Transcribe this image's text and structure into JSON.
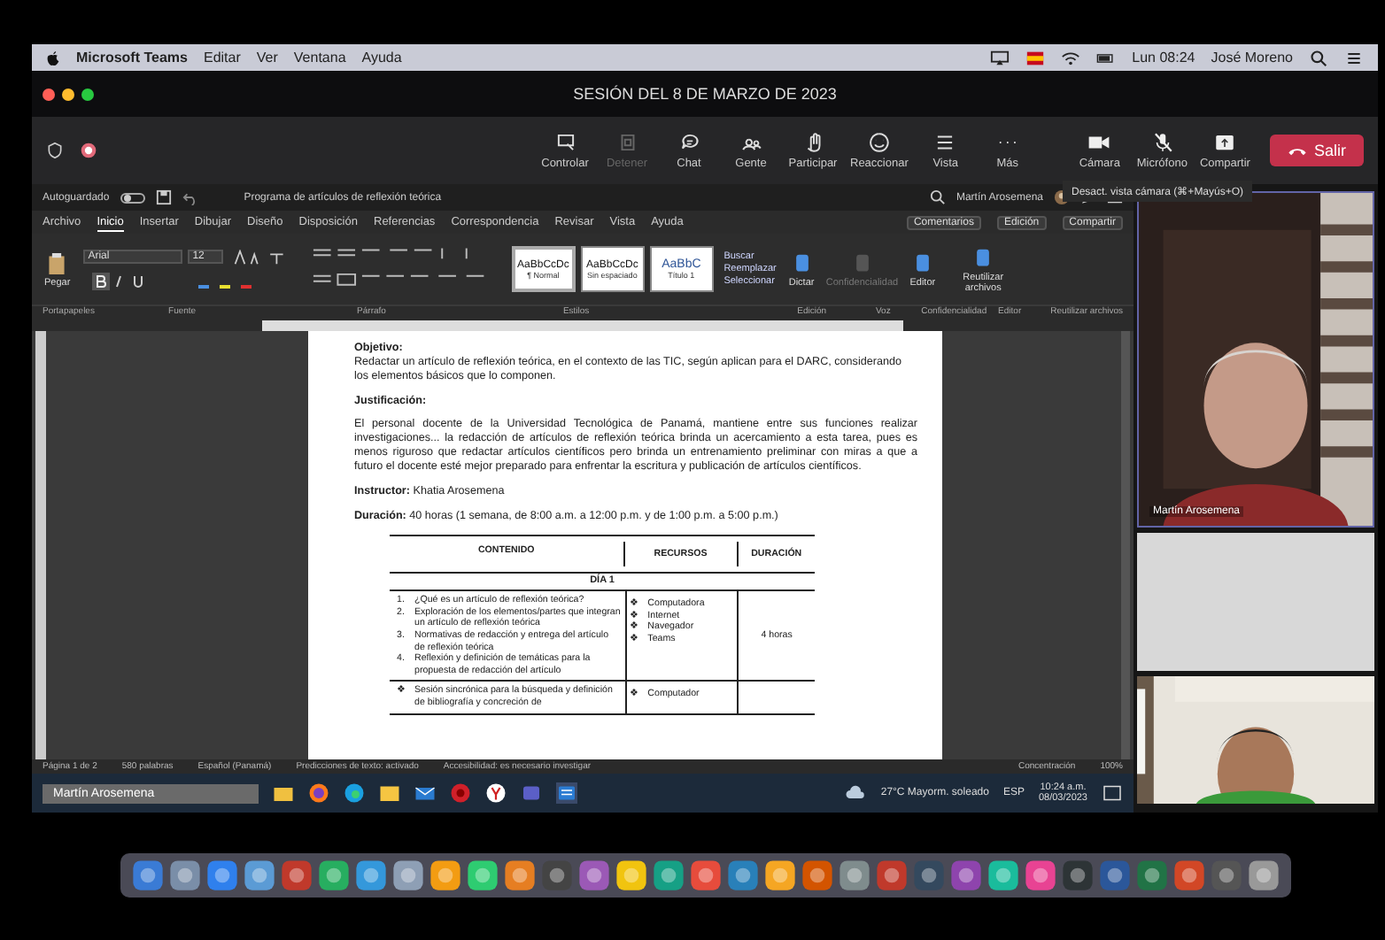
{
  "menubar": {
    "app": "Microsoft Teams",
    "menus": [
      "Editar",
      "Ver",
      "Ventana",
      "Ayuda"
    ],
    "clock": "Lun 08:24",
    "user": "José Moreno"
  },
  "meeting": {
    "title": "SESIÓN DEL 8 DE MARZO DE 2023",
    "controls": [
      {
        "label": "Controlar",
        "disabled": false
      },
      {
        "label": "Detener",
        "disabled": true
      },
      {
        "label": "Chat",
        "disabled": false
      },
      {
        "label": "Gente",
        "disabled": false
      },
      {
        "label": "Participar",
        "disabled": false
      },
      {
        "label": "Reaccionar",
        "disabled": false
      },
      {
        "label": "Vista",
        "disabled": false
      },
      {
        "label": "Más",
        "disabled": false
      }
    ],
    "media": [
      {
        "label": "Cámara",
        "on": true
      },
      {
        "label": "Micrófono",
        "on": false
      },
      {
        "label": "Compartir",
        "on": true
      }
    ],
    "leave": "Salir"
  },
  "word": {
    "autosave": "Autoguardado",
    "autosave_on": false,
    "title": "Programa de artículos de reflexión teórica",
    "account": "Martín Arosemena",
    "tabs": [
      {
        "label": "Archivo",
        "selected": false
      },
      {
        "label": "Inicio",
        "selected": true
      },
      {
        "label": "Insertar",
        "selected": false
      },
      {
        "label": "Dibujar",
        "selected": false
      },
      {
        "label": "Diseño",
        "selected": false
      },
      {
        "label": "Disposición",
        "selected": false
      },
      {
        "label": "Referencias",
        "selected": false
      },
      {
        "label": "Correspondencia",
        "selected": false
      },
      {
        "label": "Revisar",
        "selected": false
      },
      {
        "label": "Vista",
        "selected": false
      },
      {
        "label": "Ayuda",
        "selected": false
      }
    ],
    "actions": [
      "Comentarios",
      "Edición",
      "Compartir"
    ],
    "paste": "Pegar",
    "font": "Arial",
    "size": "12",
    "styles": [
      {
        "sample": "AaBbCcDc",
        "name": "¶ Normal",
        "selected": true
      },
      {
        "sample": "AaBbCcDc",
        "name": "Sin espaciado",
        "selected": false
      },
      {
        "sample": "AaBbC",
        "name": "Título 1",
        "selected": false
      }
    ],
    "edit_items": [
      "Buscar",
      "Reemplazar",
      "Seleccionar"
    ],
    "big_buttons": [
      {
        "label": "Dictar",
        "disabled": false
      },
      {
        "label": "Confidencialidad",
        "disabled": true
      },
      {
        "label": "Editor",
        "disabled": false
      },
      {
        "label": "Reutilizar archivos",
        "disabled": false
      }
    ],
    "groups": [
      "Portapapeles",
      "Fuente",
      "Párrafo",
      "Estilos",
      "Edición",
      "Voz",
      "Confidencialidad",
      "Editor",
      "Reutilizar archivos"
    ],
    "document": {
      "objective_heading": "Objetivo:",
      "objective": "Redactar un artículo de reflexión teórica, en el contexto de las TIC, según aplican para el DARC, considerando los elementos básicos que lo componen.",
      "justification_heading": "Justificación:",
      "justification": "El personal docente de la Universidad Tecnológica de Panamá, mantiene entre sus funciones realizar investigaciones... la redacción de artículos de reflexión teórica brinda un acercamiento a esta tarea, pues es menos riguroso que redactar artículos científicos pero brinda un entrenamiento preliminar con miras a que a futuro el docente esté mejor preparado para enfrentar la escritura y publicación de artículos científicos.",
      "instructor": "**Instructor:** Khatia Arosemena",
      "duration": "**Duración:** 40 horas (1 semana, de 8:00 a.m. a 12:00 p.m. y de 1:00 p.m. a 5:00 p.m.)",
      "table": {
        "columns": [
          "CONTENIDO",
          "RECURSOS",
          "DURACIÓN"
        ],
        "day": "DÍA 1",
        "rows": [
          {
            "topics": [
              {
                "marker": "1.",
                "text": "¿Qué es un artículo de reflexión teórica?"
              },
              {
                "marker": "2.",
                "text": "Exploración de los elementos/partes que integran un artículo de reflexión teórica"
              },
              {
                "marker": "3.",
                "text": "Normativas de redacción y entrega del artículo de reflexión teórica"
              },
              {
                "marker": "4.",
                "text": "Reflexión y definición de temáticas para la propuesta de redacción del artículo"
              }
            ],
            "resources": [
              {
                "marker": "❖",
                "text": "Computadora"
              },
              {
                "marker": "❖",
                "text": "Internet"
              },
              {
                "marker": "❖",
                "text": "Navegador"
              },
              {
                "marker": "❖",
                "text": "Teams"
              }
            ],
            "duration": "4 horas"
          },
          {
            "topics": [
              {
                "marker": "❖",
                "text": "Sesión sincrónica para la búsqueda y definición de bibliografía y concreción de"
              }
            ],
            "resources": [
              {
                "marker": "❖",
                "text": "Computador"
              }
            ]
          }
        ]
      }
    },
    "status": [
      "Página 1 de 2",
      "580 palabras",
      "Español (Panamá)",
      "Predicciones de texto: activado",
      "Accesibilidad: es necesario investigar"
    ],
    "focus": "Concentración",
    "zoom": "100%"
  },
  "taskbar": {
    "presenter": "Martín Arosemena",
    "weather": "27°C Mayorm. soleado",
    "lang": "ESP",
    "time": "10:24 a.m.",
    "date": "08/03/2023"
  },
  "videos": {
    "tooltip": "Desact. vista cámara (⌘+Mayús+O)",
    "participants": [
      {
        "name": "Martín Arosemena",
        "selected": true
      }
    ]
  }
}
